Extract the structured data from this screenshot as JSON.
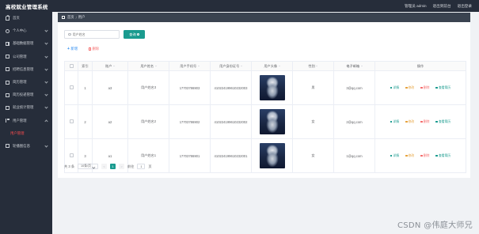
{
  "app": {
    "title": "高校就业管理系统"
  },
  "topbar": {
    "user_label": "管理员 admin",
    "back_label": "退出到前台",
    "logout_label": "退出登录"
  },
  "sidebar": {
    "items": [
      {
        "label": "首页",
        "icon": "home-icon"
      },
      {
        "label": "个人中心",
        "icon": "user-icon"
      },
      {
        "label": "基础数据管理",
        "icon": "grid-icon"
      },
      {
        "label": "公司管理",
        "icon": "doc-icon"
      },
      {
        "label": "招聘信息管理",
        "icon": "doc-icon"
      },
      {
        "label": "简历管理",
        "icon": "doc-icon"
      },
      {
        "label": "简历投递管理",
        "icon": "doc-icon"
      },
      {
        "label": "就业统计管理",
        "icon": "doc-icon"
      },
      {
        "label": "用户管理",
        "icon": "flag-icon"
      }
    ],
    "active_sub": "用户管理",
    "last_item": {
      "label": "轮播图信息",
      "icon": "doc-icon"
    }
  },
  "breadcrumb": {
    "home": "首页",
    "current": "用户"
  },
  "search": {
    "placeholder": "用户姓名",
    "button_label": "查询"
  },
  "actions": {
    "add_label": "新增",
    "delete_label": "删除"
  },
  "table": {
    "headers": [
      "索引",
      "账户",
      "用户姓名",
      "用户手机号",
      "用户身份证号",
      "用户头像",
      "性别",
      "电子邮箱",
      "操作"
    ],
    "rows": [
      {
        "index": "1",
        "account": "a3",
        "name": "用户姓名3",
        "phone": "17703786903",
        "idcard": "410224199610232003",
        "gender": "男",
        "email": "3@qq.com"
      },
      {
        "index": "2",
        "account": "a2",
        "name": "用户姓名2",
        "phone": "17703786902",
        "idcard": "410224199610232002",
        "gender": "女",
        "email": "2@qq.com"
      },
      {
        "index": "3",
        "account": "a1",
        "name": "用户姓名1",
        "phone": "17703786901",
        "idcard": "410224199610232001",
        "gender": "女",
        "email": "1@qq.com"
      }
    ],
    "ops": {
      "detail": "详情",
      "edit": "修改",
      "delete": "删除",
      "comment": "查看简历"
    }
  },
  "pagination": {
    "total": "共 3 条",
    "page_size": "10条/页",
    "prev": "<",
    "current_page": "1",
    "next": ">",
    "goto_label": "前往",
    "goto_value": "1",
    "page_suffix": "页"
  },
  "watermark": "CSDN @伟庭大师兄",
  "colors": {
    "accent": "#1a9b8f",
    "sidebar_bg": "#262d3a",
    "danger": "#f56c6c",
    "warning": "#e6a23c",
    "link": "#2d8cf0"
  }
}
